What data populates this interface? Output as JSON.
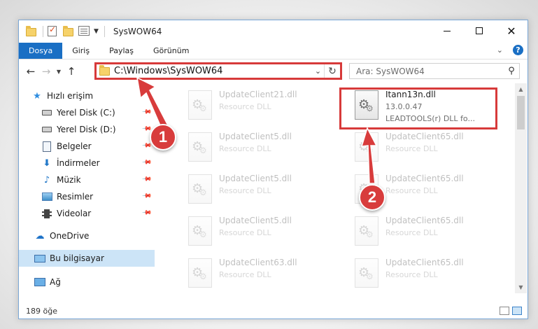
{
  "window": {
    "title": "SysWOW64"
  },
  "ribbon": {
    "tabs": [
      "Dosya",
      "Giriş",
      "Paylaş",
      "Görünüm"
    ],
    "help_label": "?"
  },
  "navigation": {
    "address": "C:\\Windows\\SysWOW64",
    "search_placeholder": "Ara: SysWOW64"
  },
  "sidebar": {
    "quick_access": "Hızlı erişim",
    "items": [
      {
        "label": "Yerel Disk (C:)",
        "icon": "drive-icon",
        "pinned": true
      },
      {
        "label": "Yerel Disk (D:)",
        "icon": "drive-icon",
        "pinned": true
      },
      {
        "label": "Belgeler",
        "icon": "documents-icon",
        "pinned": true
      },
      {
        "label": "İndirmeler",
        "icon": "download-icon",
        "pinned": true
      },
      {
        "label": "Müzik",
        "icon": "music-icon",
        "pinned": true
      },
      {
        "label": "Resimler",
        "icon": "pictures-icon",
        "pinned": true
      },
      {
        "label": "Videolar",
        "icon": "videos-icon",
        "pinned": true
      }
    ],
    "onedrive": "OneDrive",
    "this_pc": "Bu bilgisayar",
    "network": "Ağ"
  },
  "files": {
    "left_column": [
      {
        "name": "UpdateClient21.dll",
        "type": "Resource DLL"
      },
      {
        "name": "UpdateClient5.dll",
        "type": "Resource DLL"
      },
      {
        "name": "UpdateClient5.dll",
        "type": "Resource DLL"
      },
      {
        "name": "UpdateClient5.dll",
        "type": "Resource DLL"
      },
      {
        "name": "UpdateClient63.dll",
        "type": "Resource DLL"
      }
    ],
    "highlighted": {
      "name": "Itann13n.dll",
      "version": "13.0.0.47",
      "description": "LEADTOOLS(r) DLL fo..."
    },
    "right_column": [
      {
        "name": "UpdateClient65.dll",
        "type": "Resource DLL"
      },
      {
        "name": "UpdateClient65.dll",
        "type": "Resource DLL"
      },
      {
        "name": "UpdateClient65.dll",
        "type": "Resource DLL"
      },
      {
        "name": "UpdateClient65.dll",
        "type": "Resource DLL"
      }
    ]
  },
  "status": {
    "count": "189 öğe"
  },
  "annotations": {
    "badge_1": "1",
    "badge_2": "2",
    "color": "#d73a3a"
  }
}
